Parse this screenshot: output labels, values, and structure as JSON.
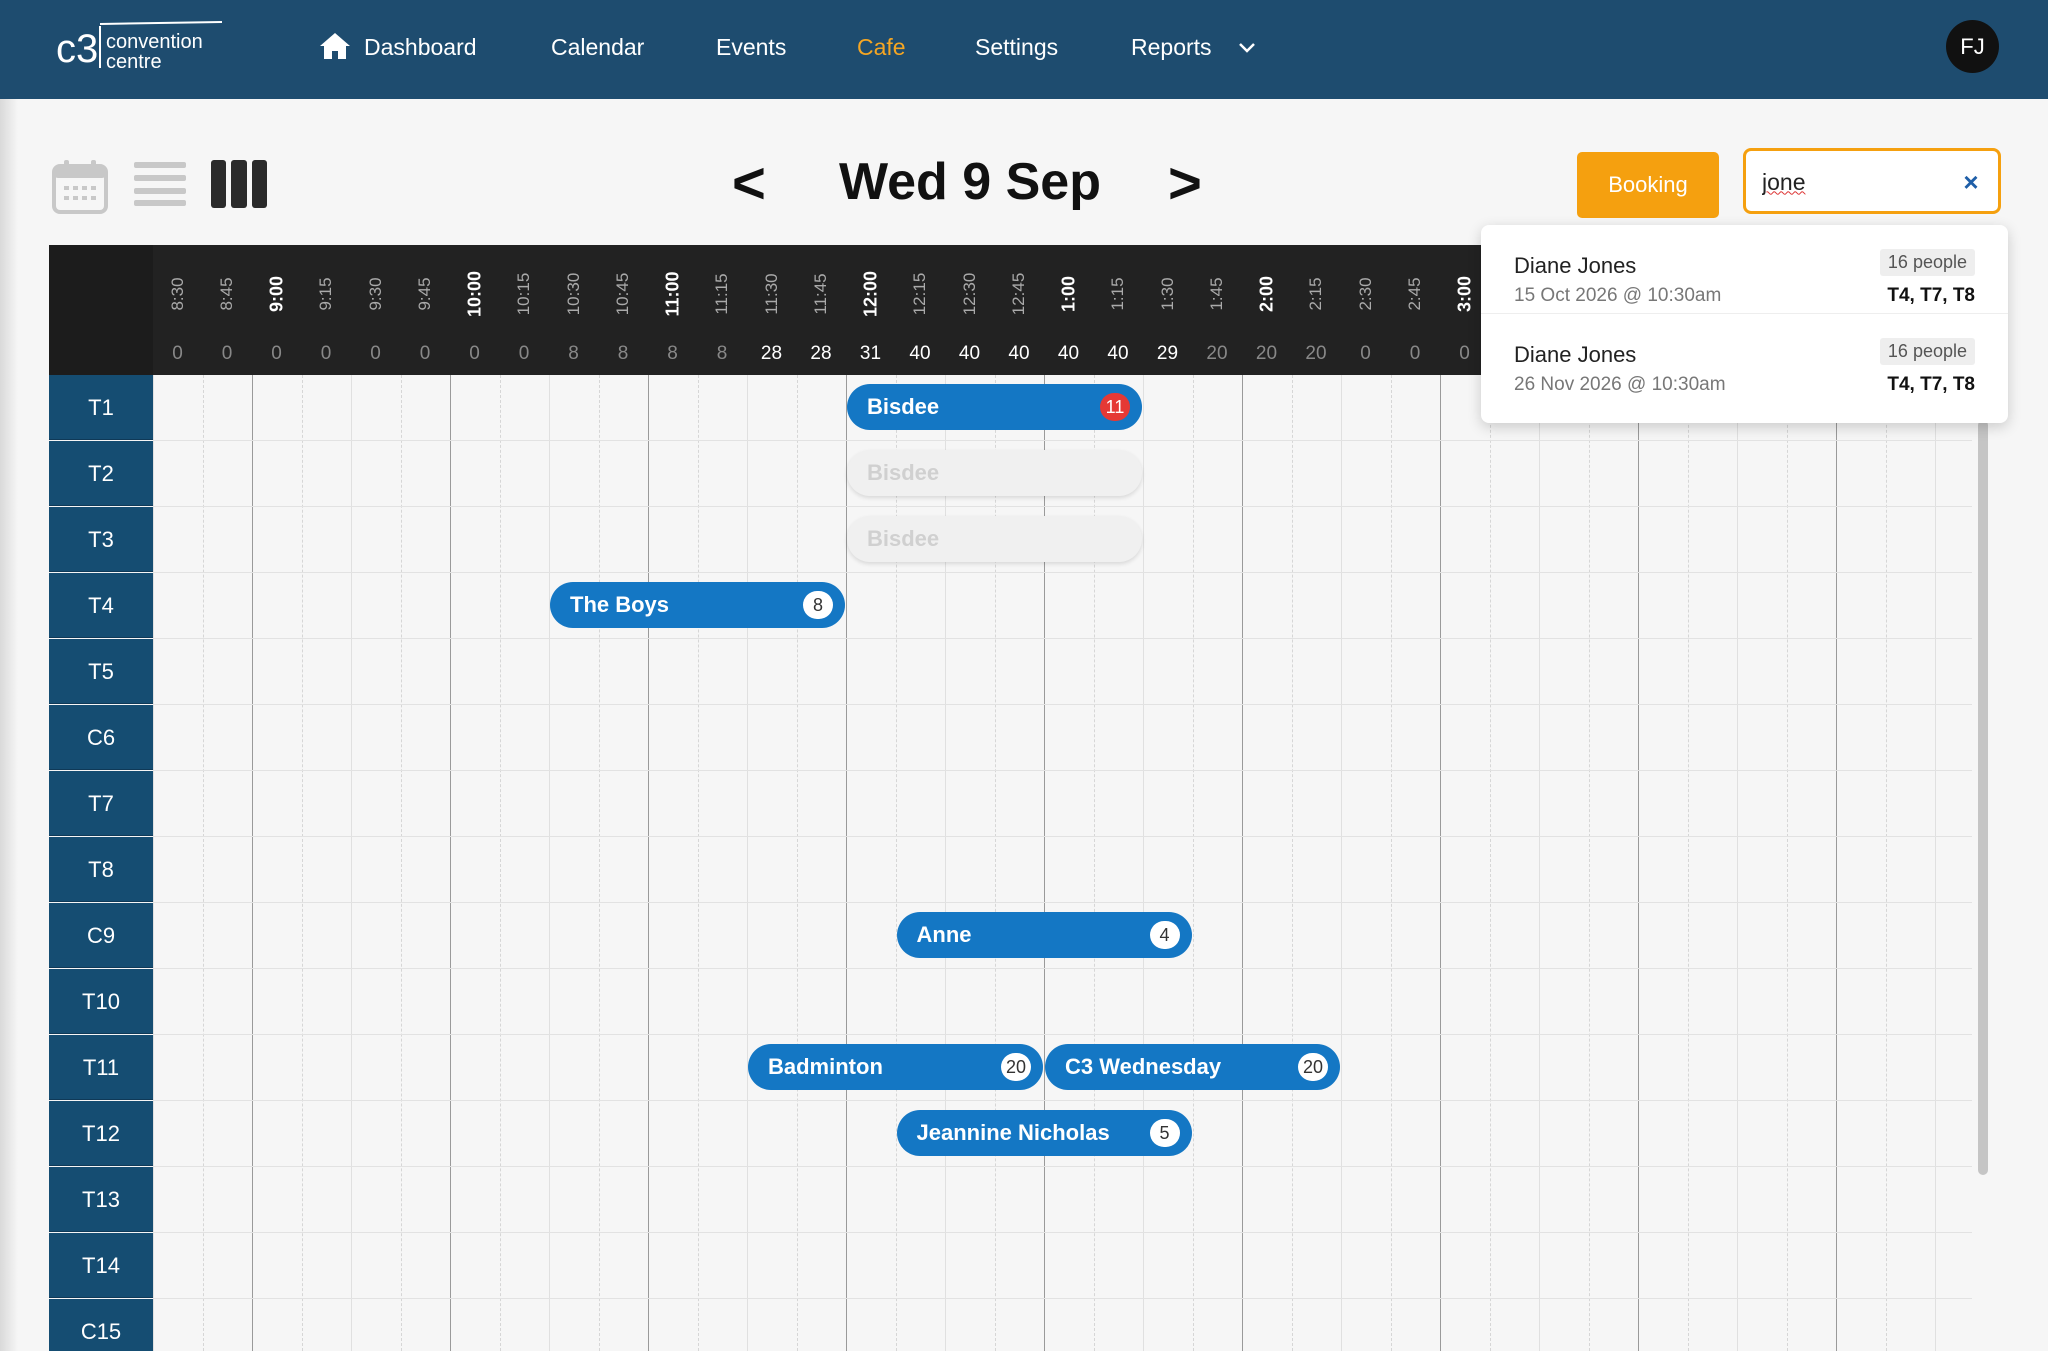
{
  "nav": {
    "logo_mark": "c3",
    "logo_text_1": "convention",
    "logo_text_2": "centre",
    "items": [
      {
        "label": "Dashboard",
        "icon": "home-icon"
      },
      {
        "label": "Calendar"
      },
      {
        "label": "Events"
      },
      {
        "label": "Cafe",
        "active": true
      },
      {
        "label": "Settings"
      },
      {
        "label": "Reports",
        "icon": "chevron-down-icon"
      }
    ],
    "avatar": "FJ"
  },
  "toolbar": {
    "views": [
      "month-calendar-icon",
      "list-view-icon",
      "column-view-icon"
    ],
    "prev": "<",
    "next": ">",
    "date": "Wed 9 Sep",
    "booking_label": "Booking",
    "search_value": "jone",
    "clear": "×"
  },
  "grid": {
    "slots": [
      {
        "time": "8:30",
        "count": "0"
      },
      {
        "time": "8:45",
        "count": "0"
      },
      {
        "time": "9:00",
        "count": "0",
        "hour": true
      },
      {
        "time": "9:15",
        "count": "0"
      },
      {
        "time": "9:30",
        "count": "0"
      },
      {
        "time": "9:45",
        "count": "0"
      },
      {
        "time": "10:00",
        "count": "0",
        "hour": true
      },
      {
        "time": "10:15",
        "count": "0"
      },
      {
        "time": "10:30",
        "count": "8"
      },
      {
        "time": "10:45",
        "count": "8"
      },
      {
        "time": "11:00",
        "count": "8",
        "hour": true
      },
      {
        "time": "11:15",
        "count": "8"
      },
      {
        "time": "11:30",
        "count": "28"
      },
      {
        "time": "11:45",
        "count": "28"
      },
      {
        "time": "12:00",
        "count": "31",
        "hour": true
      },
      {
        "time": "12:15",
        "count": "40"
      },
      {
        "time": "12:30",
        "count": "40"
      },
      {
        "time": "12:45",
        "count": "40"
      },
      {
        "time": "1:00",
        "count": "40",
        "hour": true
      },
      {
        "time": "1:15",
        "count": "40"
      },
      {
        "time": "1:30",
        "count": "29"
      },
      {
        "time": "1:45",
        "count": "20"
      },
      {
        "time": "2:00",
        "count": "20",
        "hour": true
      },
      {
        "time": "2:15",
        "count": "20"
      },
      {
        "time": "2:30",
        "count": "0"
      },
      {
        "time": "2:45",
        "count": "0"
      },
      {
        "time": "3:00",
        "count": "0",
        "hour": true
      }
    ],
    "tables": [
      "T1",
      "T2",
      "T3",
      "T4",
      "T5",
      "C6",
      "T7",
      "T8",
      "C9",
      "T10",
      "T11",
      "T12",
      "T13",
      "T14",
      "C15"
    ],
    "bookings": [
      {
        "name": "Bisdee",
        "table": 0,
        "start": 14,
        "end": 20,
        "count": "11",
        "badge": "red"
      },
      {
        "name": "Bisdee",
        "table": 1,
        "start": 14,
        "end": 20,
        "ghost": true
      },
      {
        "name": "Bisdee",
        "table": 2,
        "start": 14,
        "end": 20,
        "ghost": true
      },
      {
        "name": "The Boys",
        "table": 3,
        "start": 8,
        "end": 14,
        "count": "8"
      },
      {
        "name": "Anne",
        "table": 8,
        "start": 15,
        "end": 21,
        "count": "4"
      },
      {
        "name": "Badminton",
        "table": 10,
        "start": 12,
        "end": 18,
        "count": "20"
      },
      {
        "name": "C3 Wednesday",
        "table": 10,
        "start": 18,
        "end": 24,
        "count": "20"
      },
      {
        "name": "Jeannine Nicholas",
        "table": 11,
        "start": 15,
        "end": 21,
        "count": "5"
      }
    ]
  },
  "search_results": [
    {
      "name": "Diane Jones",
      "date": "15 Oct 2026 @ 10:30am",
      "people": "16 people",
      "tables": "T4, T7, T8"
    },
    {
      "name": "Diane Jones",
      "date": "26 Nov 2026 @ 10:30am",
      "people": "16 people",
      "tables": "T4, T7, T8"
    }
  ]
}
